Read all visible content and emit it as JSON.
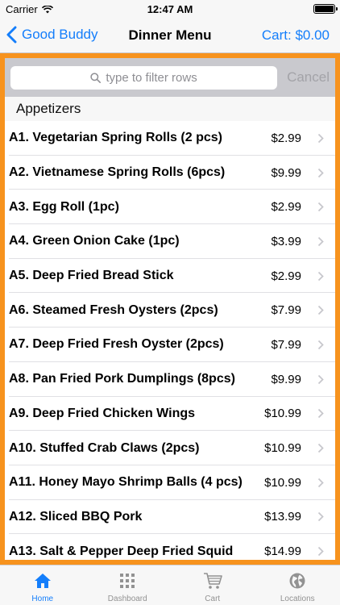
{
  "status_bar": {
    "carrier": "Carrier",
    "time": "12:47 AM"
  },
  "nav": {
    "back_label": "Good Buddy",
    "title": "Dinner Menu",
    "cart_label": "Cart: $0.00"
  },
  "search": {
    "placeholder": "type to filter rows",
    "cancel_label": "Cancel"
  },
  "section": {
    "title": "Appetizers"
  },
  "menu_items": [
    {
      "title": "A1. Vegetarian Spring Rolls (2 pcs)",
      "price": "$2.99"
    },
    {
      "title": "A2. Vietnamese Spring Rolls (6pcs)",
      "price": "$9.99"
    },
    {
      "title": "A3. Egg Roll (1pc)",
      "price": "$2.99"
    },
    {
      "title": "A4. Green Onion Cake (1pc)",
      "price": "$3.99"
    },
    {
      "title": "A5. Deep Fried Bread Stick",
      "price": "$2.99"
    },
    {
      "title": "A6. Steamed Fresh Oysters (2pcs)",
      "price": "$7.99"
    },
    {
      "title": "A7. Deep Fried Fresh Oyster (2pcs)",
      "price": "$7.99"
    },
    {
      "title": "A8. Pan Fried Pork Dumplings (8pcs)",
      "price": "$9.99"
    },
    {
      "title": "A9. Deep Fried Chicken Wings",
      "price": "$10.99"
    },
    {
      "title": "A10. Stuffed Crab Claws (2pcs)",
      "price": "$10.99"
    },
    {
      "title": "A11. Honey Mayo Shrimp Balls (4 pcs)",
      "price": "$10.99"
    },
    {
      "title": "A12. Sliced BBQ Pork",
      "price": "$13.99"
    },
    {
      "title": "A13. Salt & Pepper Deep Fried Squid",
      "price": "$14.99"
    }
  ],
  "tabs": [
    {
      "label": "Home",
      "icon": "home-icon",
      "active": true
    },
    {
      "label": "Dashboard",
      "icon": "grid-icon",
      "active": false
    },
    {
      "label": "Cart",
      "icon": "cart-icon",
      "active": false
    },
    {
      "label": "Locations",
      "icon": "globe-icon",
      "active": false
    }
  ],
  "colors": {
    "accent": "#147efb",
    "highlight_border": "#f7931e"
  }
}
